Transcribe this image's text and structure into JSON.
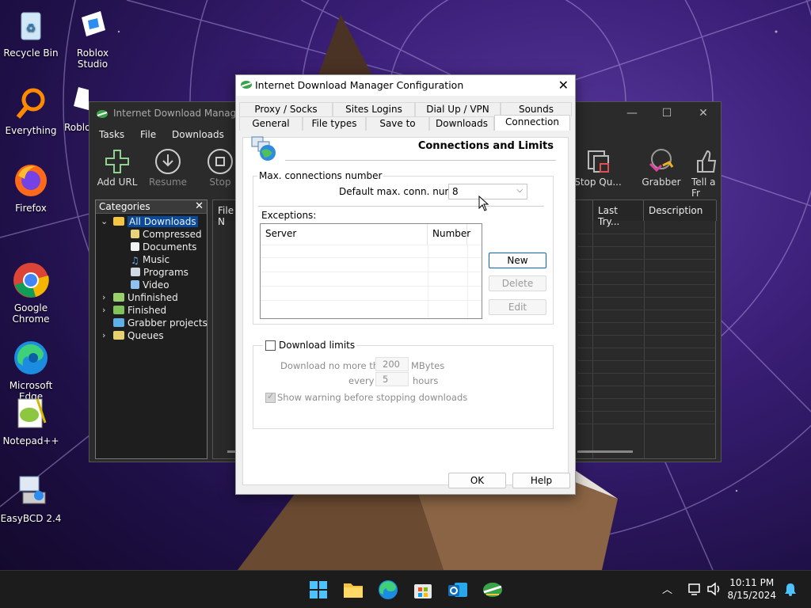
{
  "desktop": {
    "icons": [
      {
        "label": "Recycle Bin"
      },
      {
        "label": "Roblox Studio"
      },
      {
        "label": "Everything"
      },
      {
        "label": "Roblo"
      },
      {
        "label": "Firefox"
      },
      {
        "label": "Google\nChrome"
      },
      {
        "label": "Microsoft\nEdge"
      },
      {
        "label": "Notepad++"
      },
      {
        "label": "EasyBCD 2.4"
      }
    ]
  },
  "idm_main": {
    "title": "Internet Download Manager",
    "menu": [
      "Tasks",
      "File",
      "Downloads"
    ],
    "toolbar": [
      {
        "label": "Add URL",
        "icon": "plus-icon"
      },
      {
        "label": "Resume",
        "icon": "download-arrow-icon"
      },
      {
        "label": "Stop",
        "icon": "stop-icon"
      },
      {
        "label": "Stop Qu...",
        "icon": "stop-queue-icon"
      },
      {
        "label": "Grabber",
        "icon": "grabber-icon"
      },
      {
        "label": "Tell a Fr",
        "icon": "thumbs-up-icon"
      }
    ],
    "categories_title": "Categories",
    "tree": [
      {
        "label": "All Downloads",
        "level": 0
      },
      {
        "label": "Compressed",
        "level": 1
      },
      {
        "label": "Documents",
        "level": 1
      },
      {
        "label": "Music",
        "level": 1
      },
      {
        "label": "Programs",
        "level": 1
      },
      {
        "label": "Video",
        "level": 1
      },
      {
        "label": "Unfinished",
        "level": 0
      },
      {
        "label": "Finished",
        "level": 0
      },
      {
        "label": "Grabber projects",
        "level": 0
      },
      {
        "label": "Queues",
        "level": 0
      }
    ],
    "columns": {
      "file_name": "File N",
      "last_try": "Last Try...",
      "description": "Description"
    }
  },
  "dialog": {
    "title": "Internet Download Manager Configuration",
    "tabs_row1": [
      "Proxy / Socks",
      "Sites Logins",
      "Dial Up / VPN",
      "Sounds"
    ],
    "tabs_row2": [
      "General",
      "File types",
      "Save to",
      "Downloads",
      "Connection"
    ],
    "active_tab": "Connection",
    "heading": "Connections and Limits",
    "max_conn": {
      "group_label": "Max. connections number",
      "default_label": "Default max. conn. number",
      "default_value": "8"
    },
    "exceptions": {
      "label": "Exceptions:",
      "col_server": "Server",
      "col_number": "Number",
      "new_label": "New",
      "delete_label": "Delete",
      "edit_label": "Edit"
    },
    "limits": {
      "checkbox_label": "Download limits",
      "checked": false,
      "no_more_than_label": "Download no more than",
      "mbytes_value": "200",
      "mbytes_unit": "MBytes",
      "every_label": "every",
      "hours_value": "5",
      "hours_unit": "hours",
      "warning_label": "Show warning before stopping downloads",
      "warning_checked": true
    },
    "ok_label": "OK",
    "help_label": "Help"
  },
  "taskbar": {
    "time": "10:11 PM",
    "date": "8/15/2024",
    "apps": [
      "windows-start",
      "file-explorer",
      "edge",
      "microsoft-store",
      "outlook",
      "idm"
    ]
  },
  "colors": {
    "accent": "#0a64c8",
    "dark_window": "#2b2b2b",
    "dialog_bg": "#f0f0f0"
  }
}
